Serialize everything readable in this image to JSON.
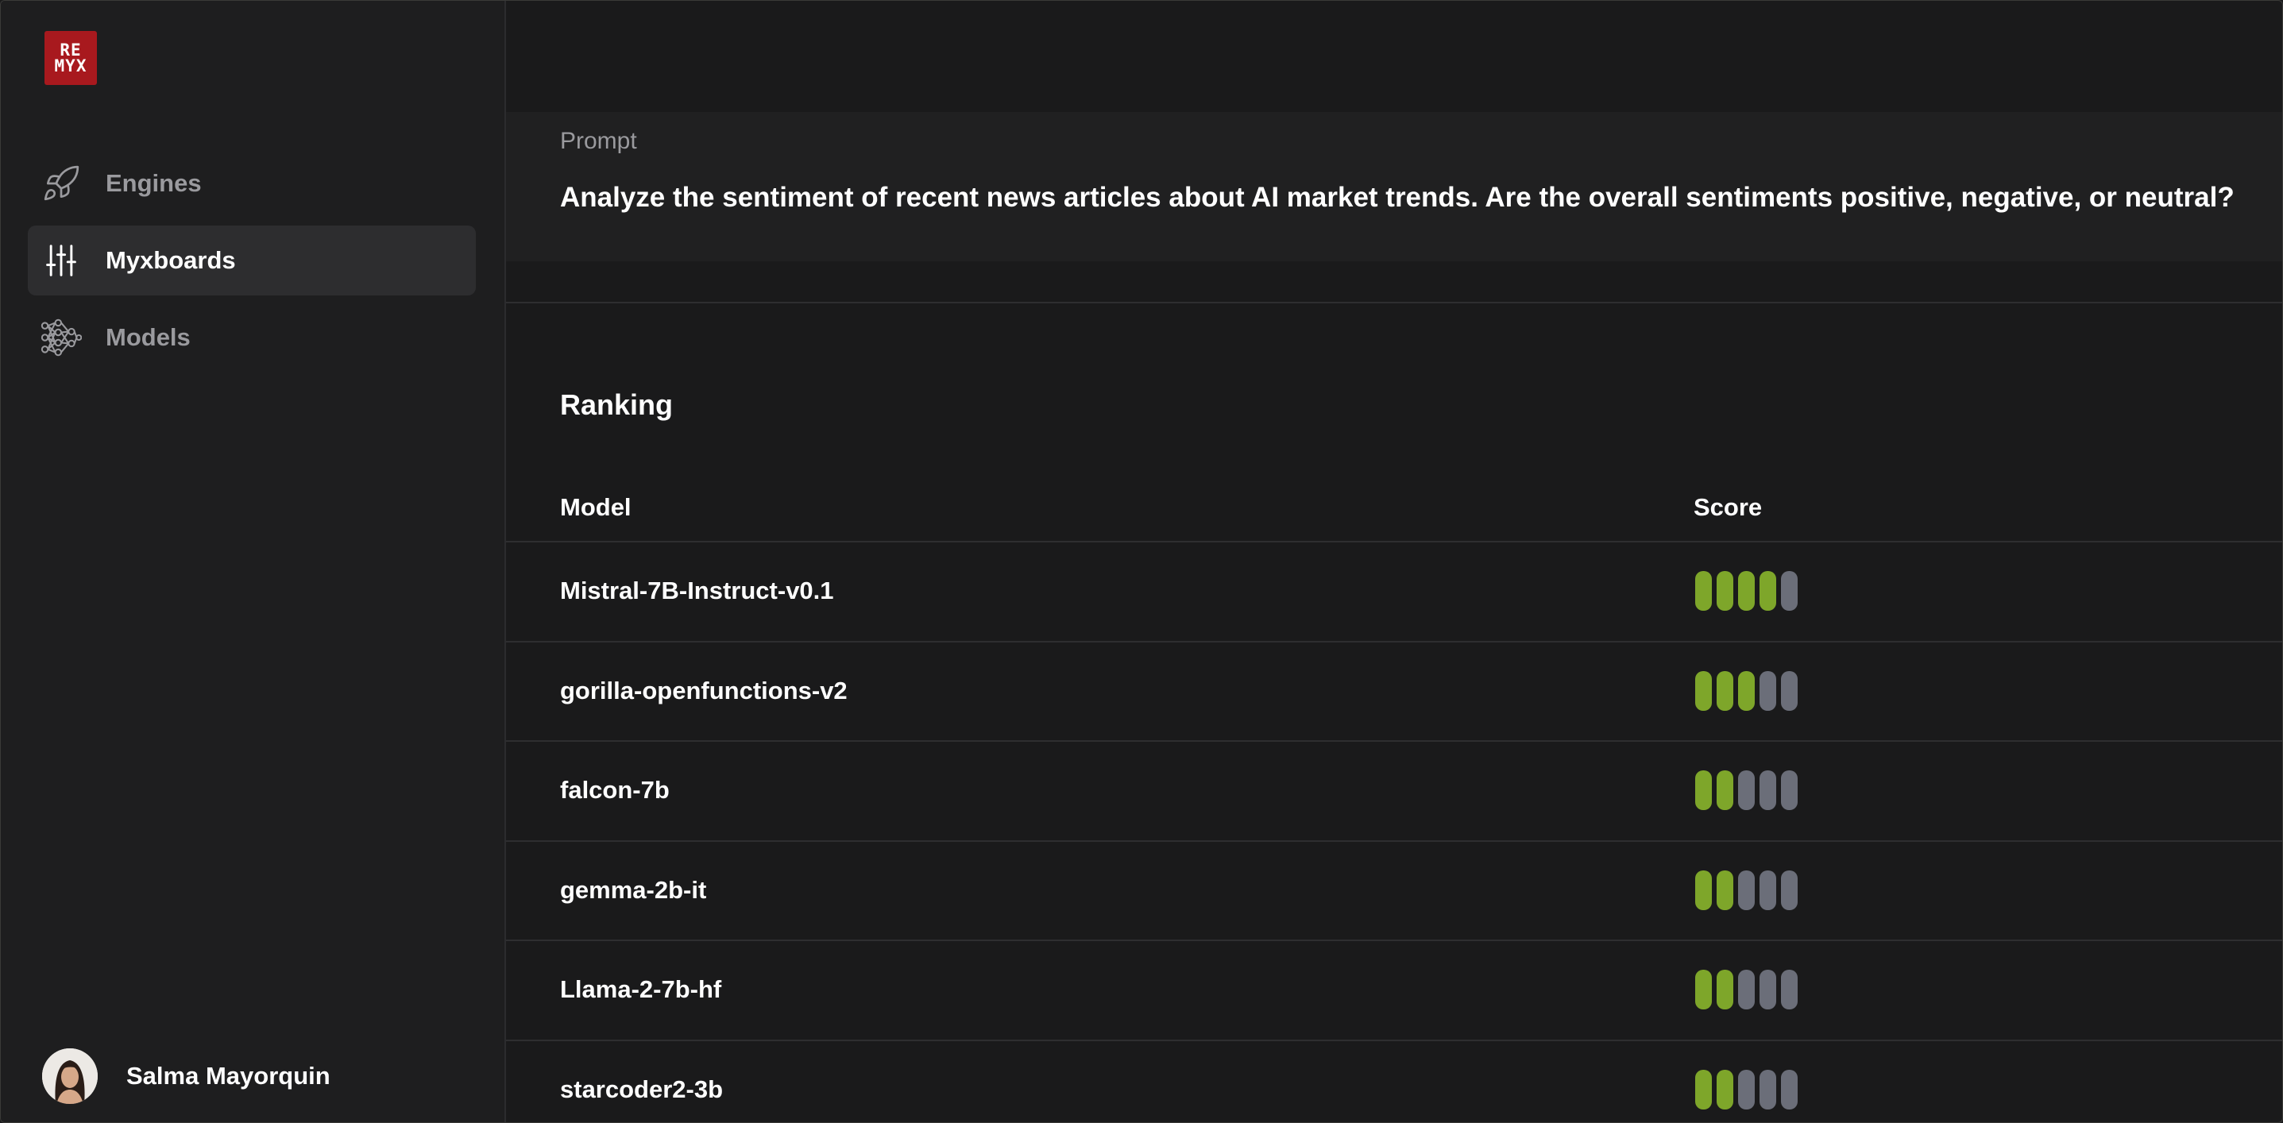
{
  "logo": {
    "line1": "RE",
    "line2": "MYX"
  },
  "nav": [
    {
      "label": "Engines",
      "icon": "rocket-icon",
      "active": false
    },
    {
      "label": "Myxboards",
      "icon": "sliders-icon",
      "active": true
    },
    {
      "label": "Models",
      "icon": "neural-network-icon",
      "active": false
    }
  ],
  "user": {
    "name": "Salma Mayorquin"
  },
  "prompt": {
    "label": "Prompt",
    "text": "Analyze the sentiment of recent news articles about AI market trends. Are the overall sentiments positive, negative, or neutral?"
  },
  "ranking": {
    "title": "Ranking",
    "columns": {
      "model": "Model",
      "score": "Score"
    },
    "max_score": 5,
    "rows": [
      {
        "model": "Mistral-7B-Instruct-v0.1",
        "score": 4
      },
      {
        "model": "gorilla-openfunctions-v2",
        "score": 3
      },
      {
        "model": "falcon-7b",
        "score": 2
      },
      {
        "model": "gemma-2b-it",
        "score": 2
      },
      {
        "model": "Llama-2-7b-hf",
        "score": 2
      },
      {
        "model": "starcoder2-3b",
        "score": 2
      }
    ]
  },
  "colors": {
    "background": "#1a1a1b",
    "sidebar": "#1e1e1f",
    "accent_logo": "#a8191e",
    "score_on": "#7ea62a",
    "score_off": "#6b6e79"
  }
}
